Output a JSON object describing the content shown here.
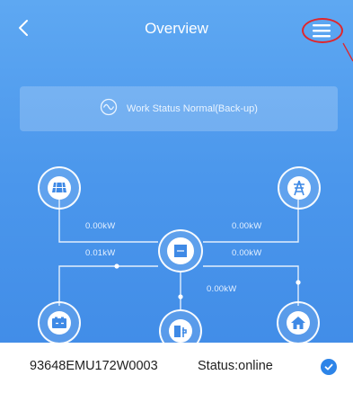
{
  "header": {
    "title": "Overview",
    "back_icon": "chevron-left-icon",
    "menu_icon": "hamburger-menu-icon"
  },
  "status_banner": {
    "icon": "waveform-icon",
    "text": "Work Status Normal(Back-up)"
  },
  "power_flow": {
    "pv_to_inverter": "0.00kW",
    "grid_to_inverter": "0.00kW",
    "battery_to_inverter": "0.01kW",
    "inverter_to_load": "0.00kW",
    "backup_load": "0.00kW",
    "nodes": {
      "pv": "solar-panel-icon",
      "grid": "power-tower-icon",
      "inverter": "inverter-icon",
      "battery": "battery-icon",
      "backup": "backup-load-icon",
      "home": "house-icon"
    }
  },
  "device": {
    "serial": "93648EMU172W0003",
    "status": "Status:online",
    "check_icon": "check-circle-icon"
  },
  "colors": {
    "background_top": "#5ea8f2",
    "background_bottom": "#3f8ae6",
    "highlight": "#e0262b",
    "check": "#2d84e8"
  }
}
